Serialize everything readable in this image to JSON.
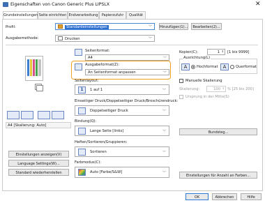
{
  "window": {
    "title": "Eigenschaften von Canon Generic Plus LIPSLX",
    "close_glyph": "✕"
  },
  "tabs": [
    {
      "label": "Grundeinstellungen",
      "active": true
    },
    {
      "label": "Seite einrichten"
    },
    {
      "label": "Endverarbeitung"
    },
    {
      "label": "Papierzufuhr"
    },
    {
      "label": "Qualität"
    }
  ],
  "profile": {
    "label": "Profil:",
    "value": "Standardeinstellungen",
    "add_button": "Hinzufügen(1)...",
    "edit_button": "Bearbeiten(2)..."
  },
  "output_method": {
    "label": "Ausgabemethode:",
    "value": "Drucken"
  },
  "page_format": {
    "label": "Seitenformat:",
    "value": "A4"
  },
  "output_format": {
    "label": "Ausgabeformat(Z):",
    "value": "An Seitenformat anpassen"
  },
  "copies": {
    "label": "Kopien(C):",
    "value": "1",
    "range": "[1 bis 9999]"
  },
  "orientation": {
    "label": "Ausrichtung(L)",
    "portrait_label": "Hochformat",
    "landscape_label": "Querformat",
    "selected": "Hochformat"
  },
  "page_layout": {
    "label": "Seitenlayout:",
    "value": "1 auf 1",
    "icon_text": "1"
  },
  "manual_scaling": {
    "label": "Manuelle Skalierung",
    "checked": false
  },
  "scaling": {
    "label": "Skalierung:",
    "value": "100",
    "range": "% [25 bis 200]"
  },
  "origin_center": {
    "label": "Ursprung in der Mitte(S)",
    "checked": false
  },
  "duplex": {
    "label": "Einseitiger Druck/Doppelseitiger Druck/Broschürendruck:",
    "value": "Doppelseitiger Druck"
  },
  "binding": {
    "label": "Bindung(Q):",
    "value": "Lange Seite [links]",
    "button": "Bundsteg..."
  },
  "sort": {
    "label": "Heften/Sortieren/Gruppieren:",
    "value": "Sortieren"
  },
  "color_mode": {
    "label": "Farbmodus(C):",
    "value": "Auto [Farbe/S&W]",
    "button": "Einstellungen für Anzahl an Farben..."
  },
  "preview": {
    "caption": "A4 [Skalierung: Auto]"
  },
  "left_buttons": {
    "show_settings": "Einstellungen anzeigen(V)",
    "language": "Language Settings(W)...",
    "restore": "Standard wiederherstellen"
  },
  "footer": {
    "ok": "OK",
    "cancel": "Abbrechen",
    "help": "Hilfe"
  }
}
